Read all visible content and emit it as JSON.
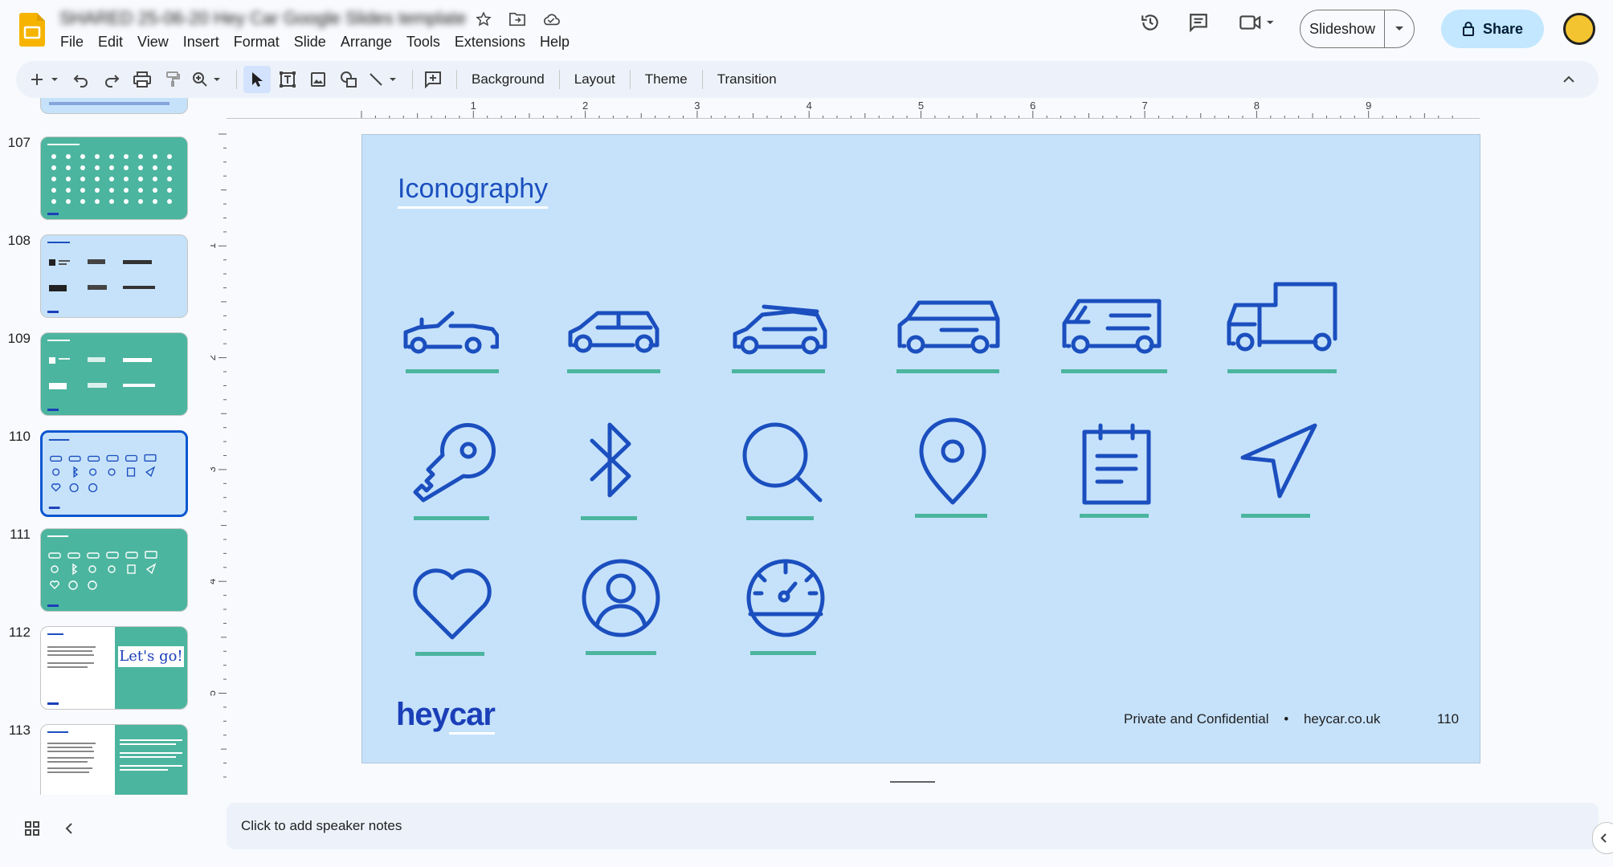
{
  "header": {
    "doc_title": "SHARED 25-06-20 Hey Car Google Slides template",
    "menu": [
      "File",
      "Edit",
      "View",
      "Insert",
      "Format",
      "Slide",
      "Arrange",
      "Tools",
      "Extensions",
      "Help"
    ],
    "slideshow_label": "Slideshow",
    "share_label": "Share"
  },
  "toolbar": {
    "background_label": "Background",
    "layout_label": "Layout",
    "theme_label": "Theme",
    "transition_label": "Transition"
  },
  "ruler": {
    "h_labels": [
      "1",
      "2",
      "3",
      "4",
      "5",
      "6",
      "7",
      "8",
      "9"
    ],
    "v_labels": [
      "1",
      "2",
      "3",
      "4",
      "5"
    ]
  },
  "filmstrip": {
    "items": [
      {
        "num": "107",
        "theme": "green"
      },
      {
        "num": "108",
        "theme": "blue"
      },
      {
        "num": "109",
        "theme": "green"
      },
      {
        "num": "110",
        "theme": "blue",
        "active": true
      },
      {
        "num": "111",
        "theme": "green"
      },
      {
        "num": "112",
        "theme": "split"
      },
      {
        "num": "113",
        "theme": "split"
      }
    ],
    "thumb_112_text": "Let's go!"
  },
  "slide": {
    "title": "Iconography",
    "logo_hey": "hey",
    "logo_car": "car",
    "footer_left": "Private and Confidential",
    "footer_sep": "•",
    "footer_site": "heycar.co.uk",
    "page_number": "110",
    "icons": [
      "convertible-car-icon",
      "hatchback-car-icon",
      "estate-car-icon",
      "suv-car-icon",
      "van-icon",
      "truck-icon",
      "key-icon",
      "bluetooth-icon",
      "search-icon",
      "location-pin-icon",
      "notepad-icon",
      "navigation-arrow-icon",
      "heart-icon",
      "user-profile-icon",
      "speedometer-icon"
    ],
    "icon_color": "#1b4fbf",
    "underline_color": "#4cb59f",
    "background_color": "#c6e2fa"
  },
  "notes": {
    "placeholder": "Click to add speaker notes"
  }
}
